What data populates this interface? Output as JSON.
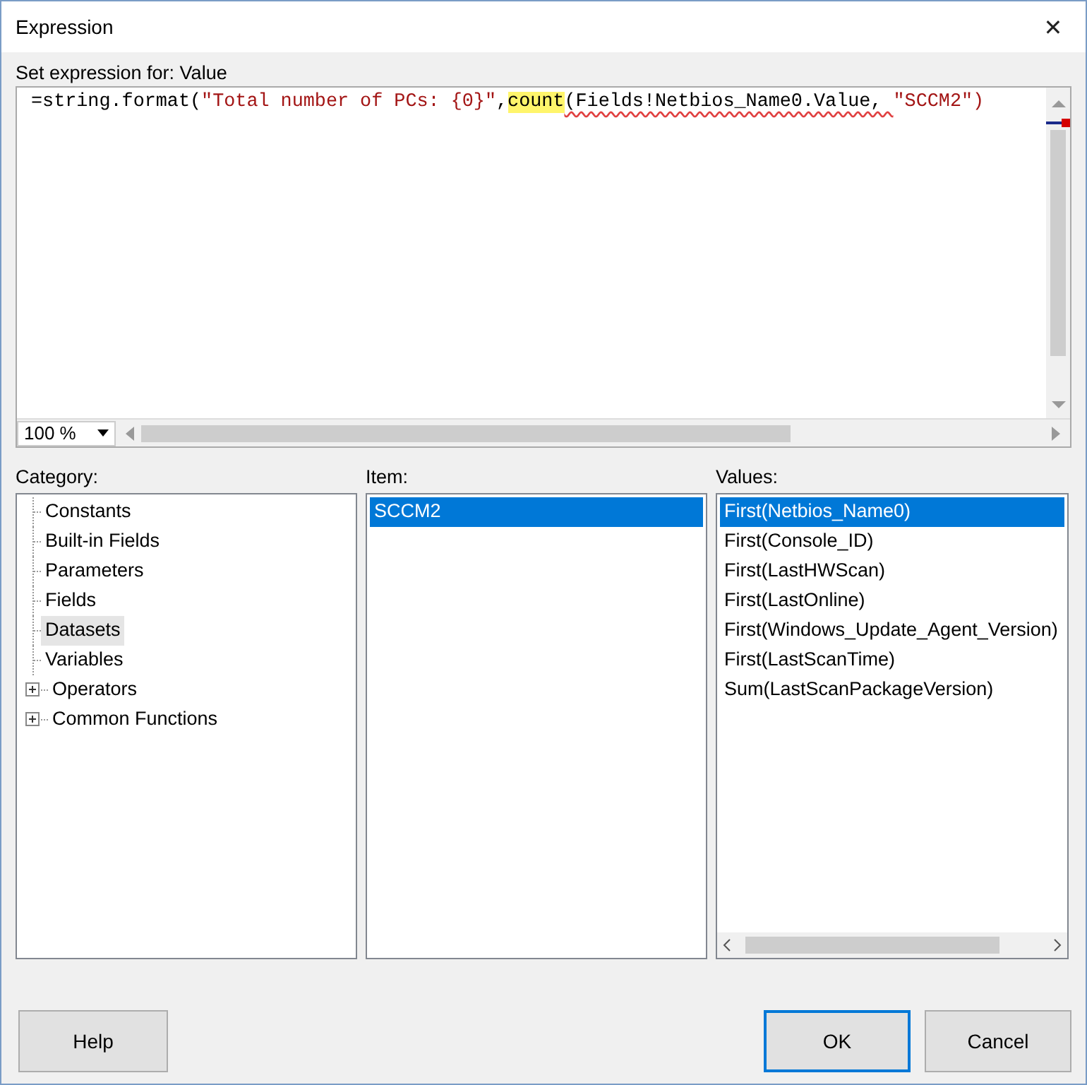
{
  "window": {
    "title": "Expression",
    "close": "✕"
  },
  "editor": {
    "label": "Set expression for: Value",
    "segments": [
      {
        "kind": "plain",
        "text": "=string.format("
      },
      {
        "kind": "string",
        "text": "\"Total number of PCs: {0}\""
      },
      {
        "kind": "plain",
        "text": ","
      },
      {
        "kind": "highlight",
        "text": "count"
      },
      {
        "kind": "squiggle",
        "text": "(Fields!Netbios_Name0.Value, "
      },
      {
        "kind": "string",
        "text": "\"SCCM2\")"
      }
    ],
    "zoom": "100 %"
  },
  "category": {
    "label": "Category:",
    "items": [
      {
        "kind": "leaf",
        "label": "Constants",
        "selected": false
      },
      {
        "kind": "leaf",
        "label": "Built-in Fields",
        "selected": false
      },
      {
        "kind": "leaf",
        "label": "Parameters",
        "selected": false
      },
      {
        "kind": "leaf",
        "label": "Fields",
        "selected": false
      },
      {
        "kind": "leaf",
        "label": "Datasets",
        "selected": true
      },
      {
        "kind": "leaf",
        "label": "Variables",
        "selected": false
      },
      {
        "kind": "node",
        "label": "Operators",
        "selected": false,
        "expanded": false
      },
      {
        "kind": "node",
        "label": "Common Functions",
        "selected": false,
        "expanded": false
      }
    ]
  },
  "item": {
    "label": "Item:",
    "items": [
      {
        "label": "SCCM2",
        "selected": true
      }
    ]
  },
  "values": {
    "label": "Values:",
    "items": [
      {
        "label": "First(Netbios_Name0)",
        "selected": true
      },
      {
        "label": "First(Console_ID)",
        "selected": false
      },
      {
        "label": "First(LastHWScan)",
        "selected": false
      },
      {
        "label": "First(LastOnline)",
        "selected": false
      },
      {
        "label": "First(Windows_Update_Agent_Version)",
        "selected": false
      },
      {
        "label": "First(LastScanTime)",
        "selected": false
      },
      {
        "label": "Sum(LastScanPackageVersion)",
        "selected": false
      }
    ]
  },
  "buttons": {
    "help": "Help",
    "ok": "OK",
    "cancel": "Cancel"
  }
}
